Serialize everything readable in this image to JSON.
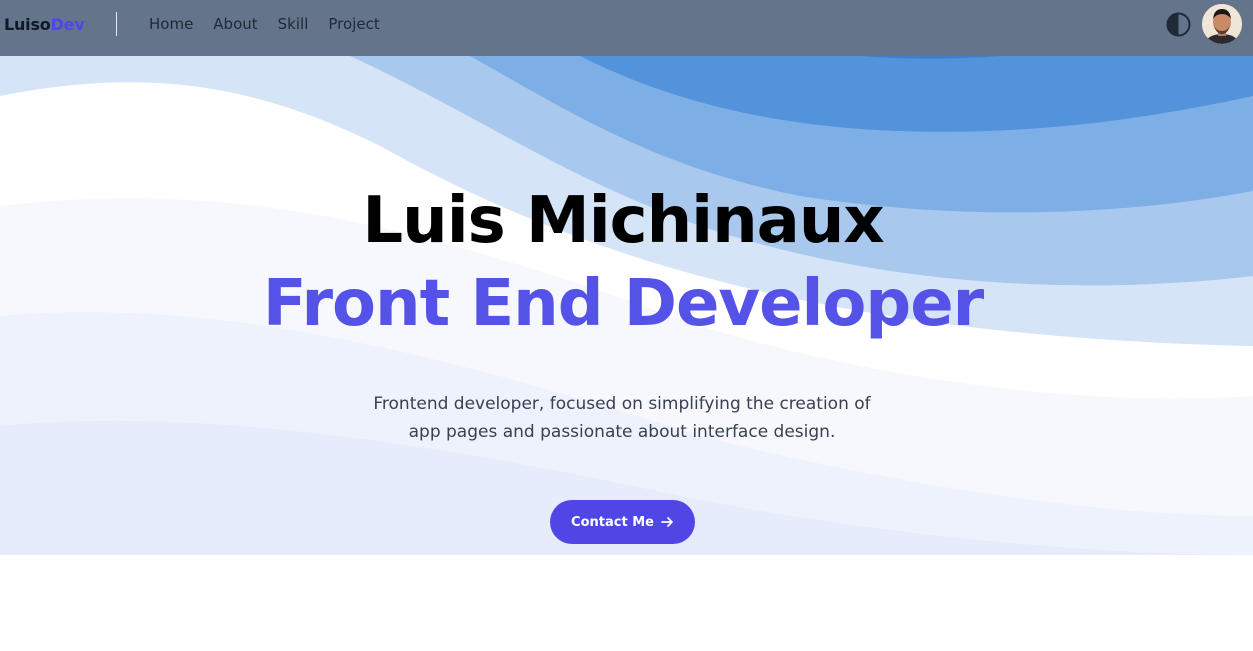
{
  "logo": {
    "text": "Luiso",
    "accent": "Dev"
  },
  "nav": {
    "items": [
      {
        "label": "Home"
      },
      {
        "label": "About"
      },
      {
        "label": "Skill"
      },
      {
        "label": "Project"
      }
    ]
  },
  "header_icons": {
    "theme_toggle": "contrast-icon",
    "avatar": "user-avatar"
  },
  "hero": {
    "name": "Luis Michinaux",
    "role": "Front End Developer",
    "description": "Frontend developer, focused on simplifying the creation of app pages and passionate about interface design.",
    "cta_label": "Contact Me",
    "cta_icon": "arrow-right-icon"
  },
  "colors": {
    "navbar": "#64748b",
    "accent": "#4f46e5",
    "role_text": "#5552e8",
    "wave_dark": "#5393dc",
    "wave_light": "#e4ecfb"
  }
}
